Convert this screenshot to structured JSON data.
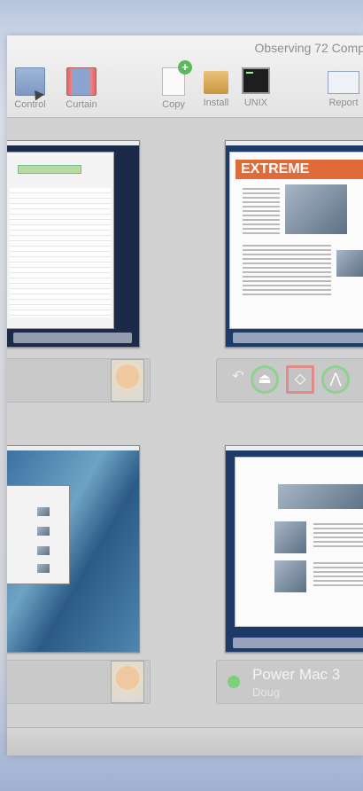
{
  "toolbar": {
    "title": "Observing 72 Comp",
    "buttons": [
      {
        "label": "Control",
        "icon": "control-icon"
      },
      {
        "label": "Curtain",
        "icon": "curtain-icon"
      },
      {
        "label": "Copy",
        "icon": "copy-icon"
      },
      {
        "label": "Install",
        "icon": "install-icon"
      },
      {
        "label": "UNIX",
        "icon": "unix-icon"
      },
      {
        "label": "Report",
        "icon": "report-icon"
      }
    ]
  },
  "tiles": [
    {
      "id": "top-left",
      "screen_content": "spreadsheet",
      "status": "offline"
    },
    {
      "id": "top-right",
      "screen_content": "EXTREME",
      "controls": [
        "back-arrow-icon",
        "eject-icon",
        "diamond-icon",
        "chart-icon"
      ]
    },
    {
      "id": "bottom-left",
      "screen_content": "desktop"
    },
    {
      "id": "bottom-right",
      "computer_name": "Power Mac 3",
      "user": "Doug",
      "status": "online"
    }
  ],
  "colors": {
    "online": "#7cd07c",
    "accent_red": "#e08a8a",
    "extreme_orange": "#e06b3a"
  }
}
